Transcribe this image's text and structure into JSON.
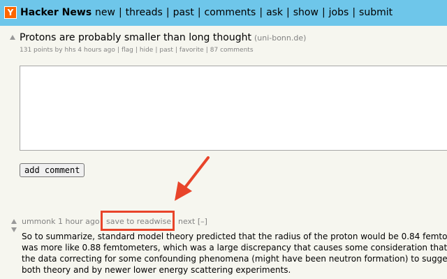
{
  "header": {
    "logo_letter": "Y",
    "brand": "Hacker News",
    "nav": [
      "new",
      "threads",
      "past",
      "comments",
      "ask",
      "show",
      "jobs",
      "submit"
    ],
    "separator": "|"
  },
  "story": {
    "title": "Protons are probably smaller than long thought",
    "domain": "(uni-bonn.de)",
    "points": "131 points by hhs 4 hours ago",
    "actions": [
      "flag",
      "hide",
      "past",
      "favorite",
      "87 comments"
    ],
    "separator": "|"
  },
  "comment_form": {
    "text": "",
    "submit_label": "add comment"
  },
  "comment": {
    "user": "ummonk",
    "age": "1 hour ago",
    "extension_action": "save to readwise",
    "next": "next [–]",
    "lines": [
      "So to summarize, standard model theory predicted that the radius of the proton would be 0.84 femto",
      "was more like 0.88 femtometers, which was a large discrepancy that causes some consideration that",
      "the data correcting for some confounding phenomena (might have been neutron formation) to sugge",
      "both theory and by newer lower energy scattering experiments."
    ]
  },
  "annotation": {
    "highlight_color": "#e8442a",
    "arrow_color": "#e8442a"
  },
  "colors": {
    "header_bg": "#6ec6ea",
    "page_bg": "#f6f6ef",
    "logo_bg": "#ff6600",
    "meta_text": "#828282"
  }
}
